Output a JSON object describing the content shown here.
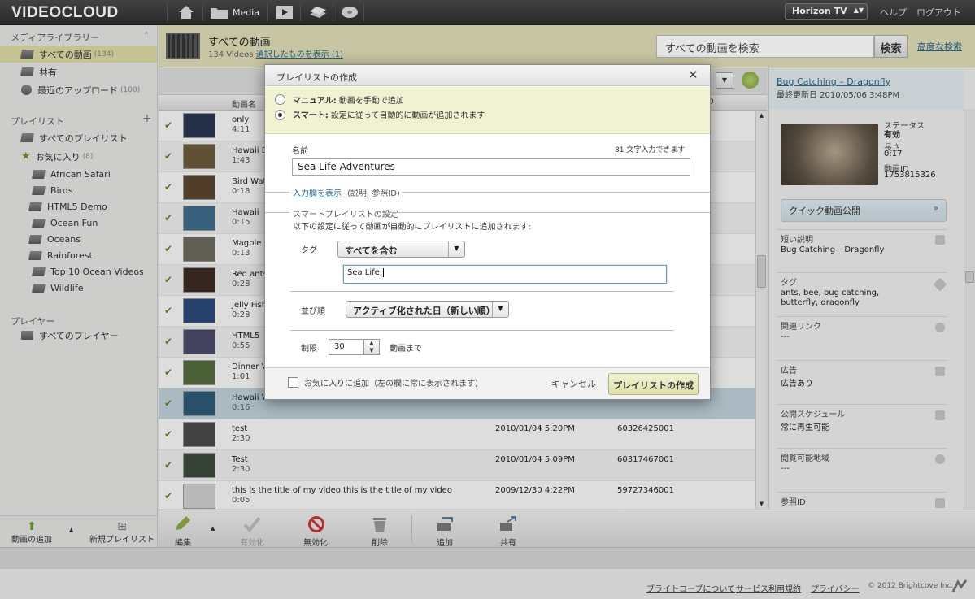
{
  "app": {
    "logo": "VIDEOCLOUD",
    "account": "Horizon TV",
    "help": "ヘルプ",
    "logout": "ログアウト"
  },
  "nav": {
    "media_label": "Media"
  },
  "sidebar": {
    "library_header": "メディアライブラリー",
    "library_items": [
      {
        "label": "すべての動画",
        "count": "(134)"
      },
      {
        "label": "共有",
        "count": ""
      },
      {
        "label": "最近のアップロード",
        "count": "(100)"
      }
    ],
    "playlist_header": "プレイリスト",
    "playlist_items": [
      {
        "label": "すべてのプレイリスト",
        "count": ""
      },
      {
        "label": "お気に入り",
        "count": "(8)"
      },
      {
        "label": "African Safari",
        "count": ""
      },
      {
        "label": "Birds",
        "count": ""
      },
      {
        "label": "HTML5 Demo",
        "count": ""
      },
      {
        "label": "Ocean Fun",
        "count": ""
      },
      {
        "label": "Oceans",
        "count": ""
      },
      {
        "label": "Rainforest",
        "count": ""
      },
      {
        "label": "Top 10 Ocean Videos",
        "count": ""
      },
      {
        "label": "Wildlife",
        "count": ""
      }
    ],
    "player_header": "プレイヤー",
    "player_items": [
      {
        "label": "すべてのプレイヤー"
      }
    ],
    "add_video": "動画の追加",
    "new_playlist": "新規プレイリスト"
  },
  "main": {
    "title": "すべての動画",
    "count": "134 Videos",
    "show_selected": "選択したものを表示 (1)",
    "search_placeholder": "すべての動画を検索",
    "search_button": "検索",
    "advanced_search": "高度な検索",
    "col_name": "動画名",
    "col_id": "ID"
  },
  "videos": [
    {
      "name": "only",
      "dur": "4:11",
      "date": "",
      "id": ""
    },
    {
      "name": "Hawaii Di",
      "dur": "1:43",
      "date": "",
      "id": ""
    },
    {
      "name": "Bird Wat",
      "dur": "0:18",
      "date": "",
      "id": ""
    },
    {
      "name": "Hawaii",
      "dur": "0:15",
      "date": "",
      "id": ""
    },
    {
      "name": "Magpie",
      "dur": "0:13",
      "date": "",
      "id": ""
    },
    {
      "name": "Red ants",
      "dur": "0:28",
      "date": "",
      "id": ""
    },
    {
      "name": "Jelly Fish",
      "dur": "0:28",
      "date": "",
      "id": ""
    },
    {
      "name": "HTML5 ",
      "dur": "0:55",
      "date": "",
      "id": ""
    },
    {
      "name": "Dinner Vi",
      "dur": "1:01",
      "date": "",
      "id": ""
    },
    {
      "name": "Hawaii Vi",
      "dur": "0:16",
      "date": "",
      "id": ""
    },
    {
      "name": "test",
      "dur": "2:30",
      "date": "2010/01/04 5:20PM",
      "id": "60326425001"
    },
    {
      "name": "Test",
      "dur": "2:30",
      "date": "2010/01/04 5:09PM",
      "id": "60317467001"
    },
    {
      "name": "this is the title of my video this is the title of my video",
      "dur": "0:05",
      "date": "2009/12/30 4:22PM",
      "id": "59727346001"
    }
  ],
  "toolbar": {
    "edit": "編集",
    "enable": "有効化",
    "disable": "無効化",
    "delete": "削除",
    "add": "追加",
    "share": "共有"
  },
  "details": {
    "title": "Bug Catching – Dragonfly",
    "updated": "最終更新日 2010/05/06 3:48PM",
    "status_label": "ステータス",
    "status_value": "有効",
    "length_label": "長さ",
    "length_value": "0:17",
    "id_label": "動画ID",
    "id_value": "1753815326",
    "quick_publish": "クイック動画公開",
    "short_desc_label": "短い説明",
    "short_desc_value": "Bug Catching – Dragonfly",
    "tags_label": "タグ",
    "tags_value": "ants, bee, bug catching, butterfly, dragonfly",
    "links_label": "関連リンク",
    "links_value": "---",
    "ads_label": "広告",
    "ads_value": "広告あり",
    "schedule_label": "公開スケジュール",
    "schedule_value": "常に再生可能",
    "geo_label": "閲覧可能地域",
    "geo_value": "---",
    "ref_label": "参照ID"
  },
  "dialog": {
    "title": "プレイリストの作成",
    "manual_label": "マニュアル:",
    "manual_desc": "動画を手動で追加",
    "smart_label": "スマート:",
    "smart_desc": "設定に従って自動的に動画が追加されます",
    "name_label": "名前",
    "char_count": "81 文字入力できます",
    "name_value": "Sea Life Adventures",
    "show_fields_link": "入力欄を表示",
    "show_fields_hint": "(説明, 参照ID)",
    "smart_section": "スマートプレイリストの設定",
    "smart_desc_text": "以下の設定に従って動画が自動的にプレイリストに追加されます:",
    "tag_label": "タグ",
    "tag_select": "すべてを含む",
    "tag_value": "Sea Life,",
    "order_label": "並び順",
    "order_select": "アクティブ化された日（新しい順）",
    "limit_label": "制限",
    "limit_value": "30",
    "limit_suffix": "動画まで",
    "favorite_label": "お気に入りに追加（左の欄に常に表示されます）",
    "cancel": "キャンセル",
    "create": "プレイリストの作成"
  },
  "footer": {
    "about": "ブライトコーブについて",
    "terms": "サービス利用規約",
    "privacy": "プライバシー",
    "copyright": "© 2012 Brightcove Inc."
  }
}
